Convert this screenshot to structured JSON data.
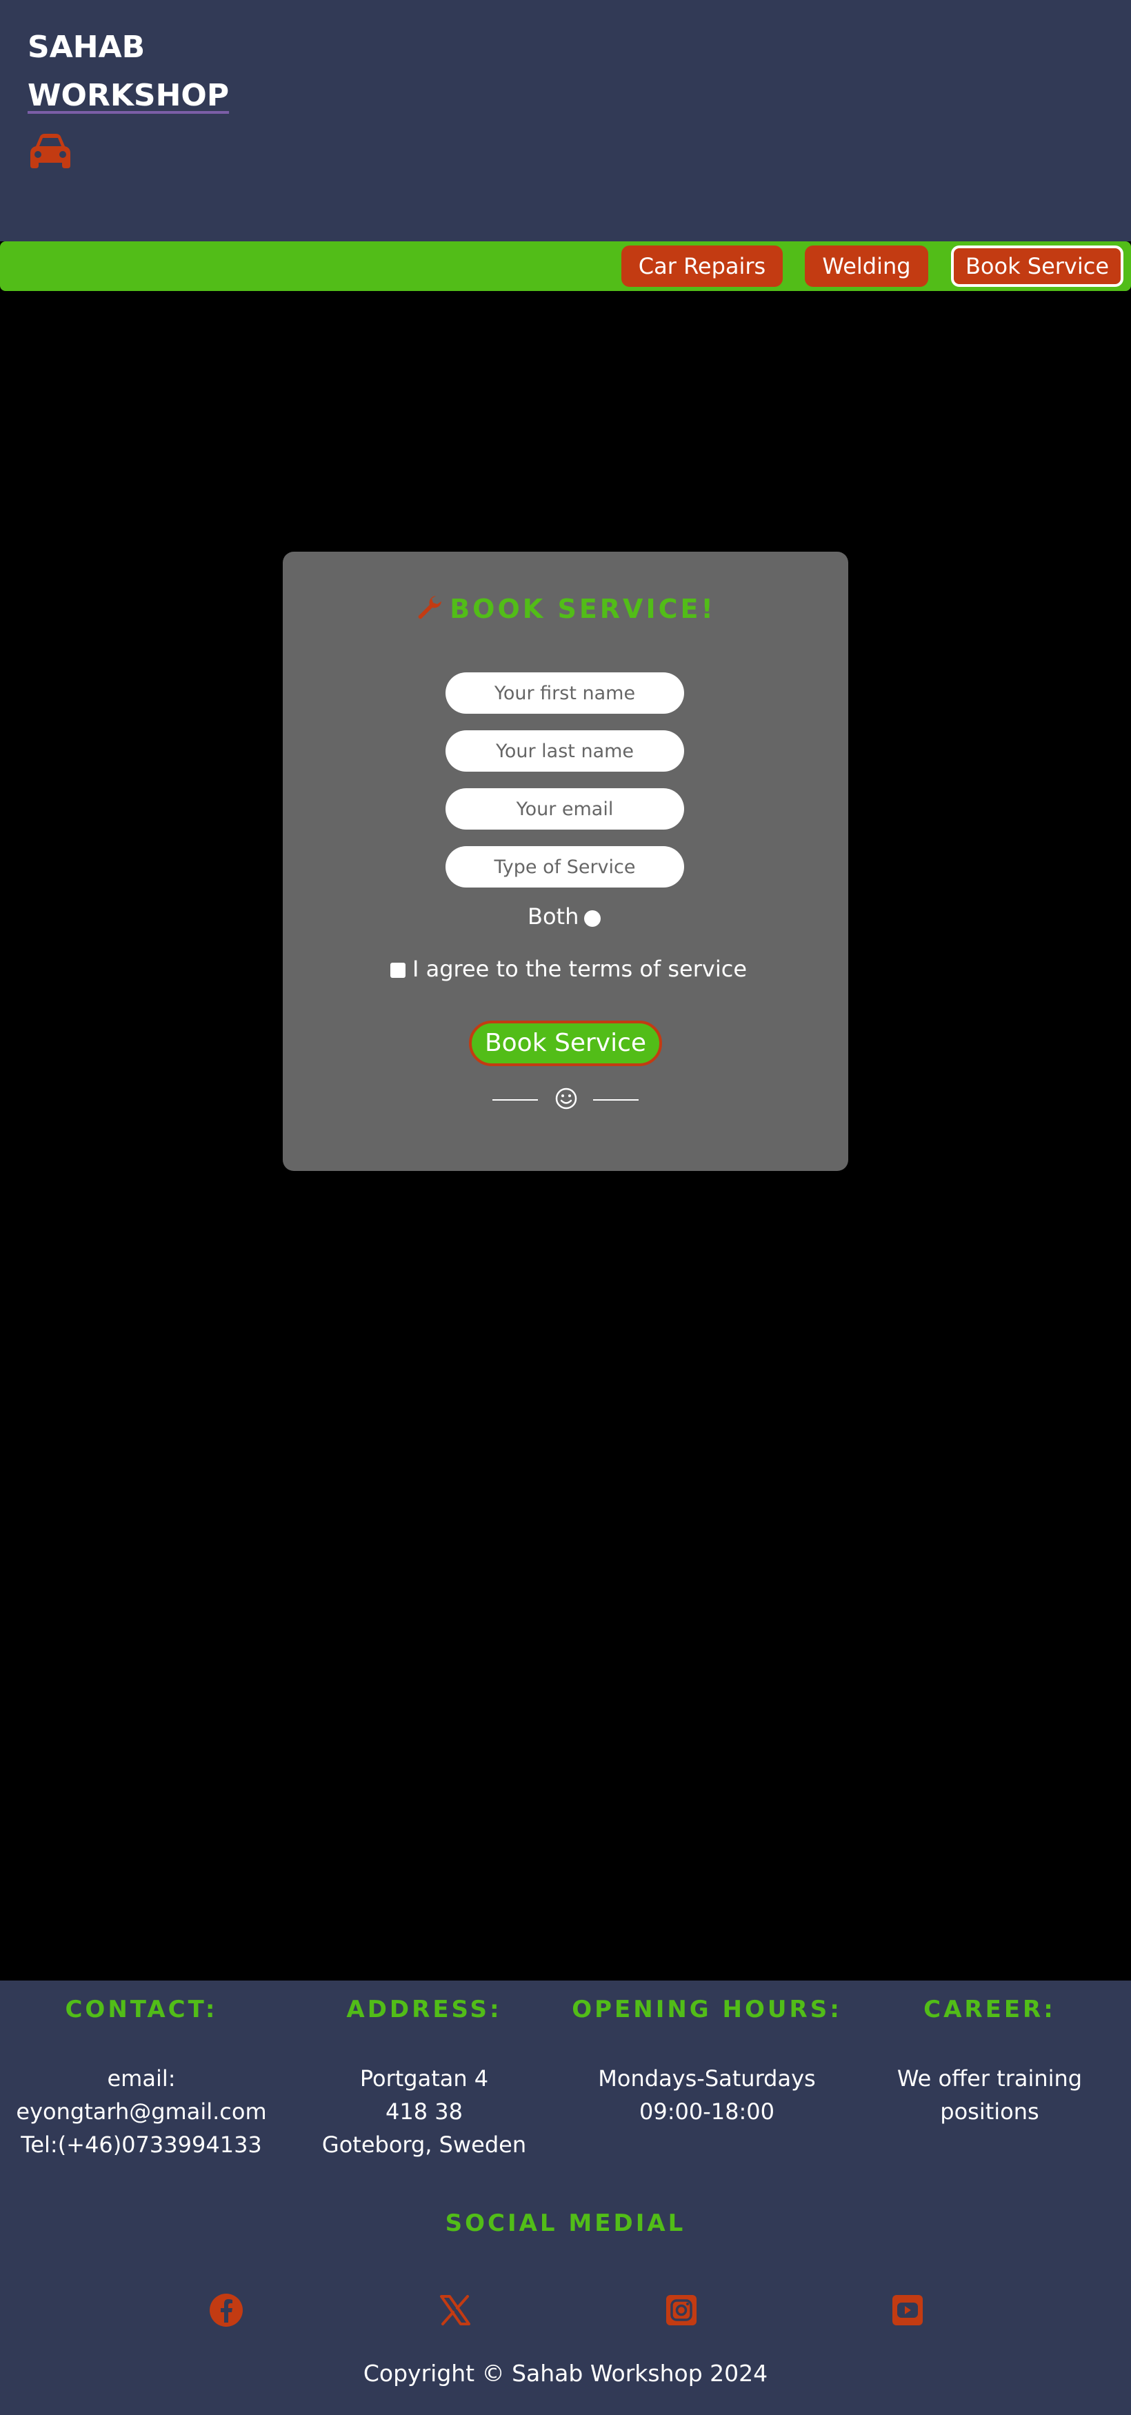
{
  "brand": {
    "line1": "SAHAB",
    "line2": "WORKSHOP",
    "icon": "car-icon"
  },
  "nav": {
    "items": [
      {
        "label": "Car Repairs"
      },
      {
        "label": "Welding"
      },
      {
        "label": "Book Service",
        "active": true
      }
    ]
  },
  "form": {
    "title": "BOOK SERVICE!",
    "title_icon": "wrench-icon",
    "first_name_placeholder": "Your first name",
    "last_name_placeholder": "Your last name",
    "email_placeholder": "Your email",
    "service_type_placeholder": "Type of Service",
    "radio_label": "Both",
    "terms_label": "I agree to the terms of service",
    "submit_label": "Book Service",
    "divider_icon": "smile-icon"
  },
  "footer": {
    "contact": {
      "heading": "CONTACT:",
      "line1": "email:",
      "line2": "eyongtarh@gmail.com",
      "line3": "Tel:(+46)0733994133"
    },
    "address": {
      "heading": "ADDRESS:",
      "line1": "Portgatan 4",
      "line2": "418 38",
      "line3": "Goteborg, Sweden"
    },
    "hours": {
      "heading": "OPENING HOURS:",
      "line1": "Mondays-Saturdays",
      "line2": "09:00-18:00"
    },
    "career": {
      "heading": "CAREER:",
      "line1": "We offer training",
      "line2": "positions"
    },
    "social_heading": "SOCIAL MEDIAL",
    "social_icons": [
      "facebook-icon",
      "x-icon",
      "instagram-icon",
      "youtube-icon"
    ],
    "copyright": "Copyright © Sahab Workshop 2024"
  },
  "colors": {
    "header_bg": "#323a56",
    "nav_bg": "#52bd18",
    "accent_orange": "#c33b12",
    "accent_green": "#52bd18",
    "card_bg": "#666666",
    "page_bg": "#000000"
  }
}
